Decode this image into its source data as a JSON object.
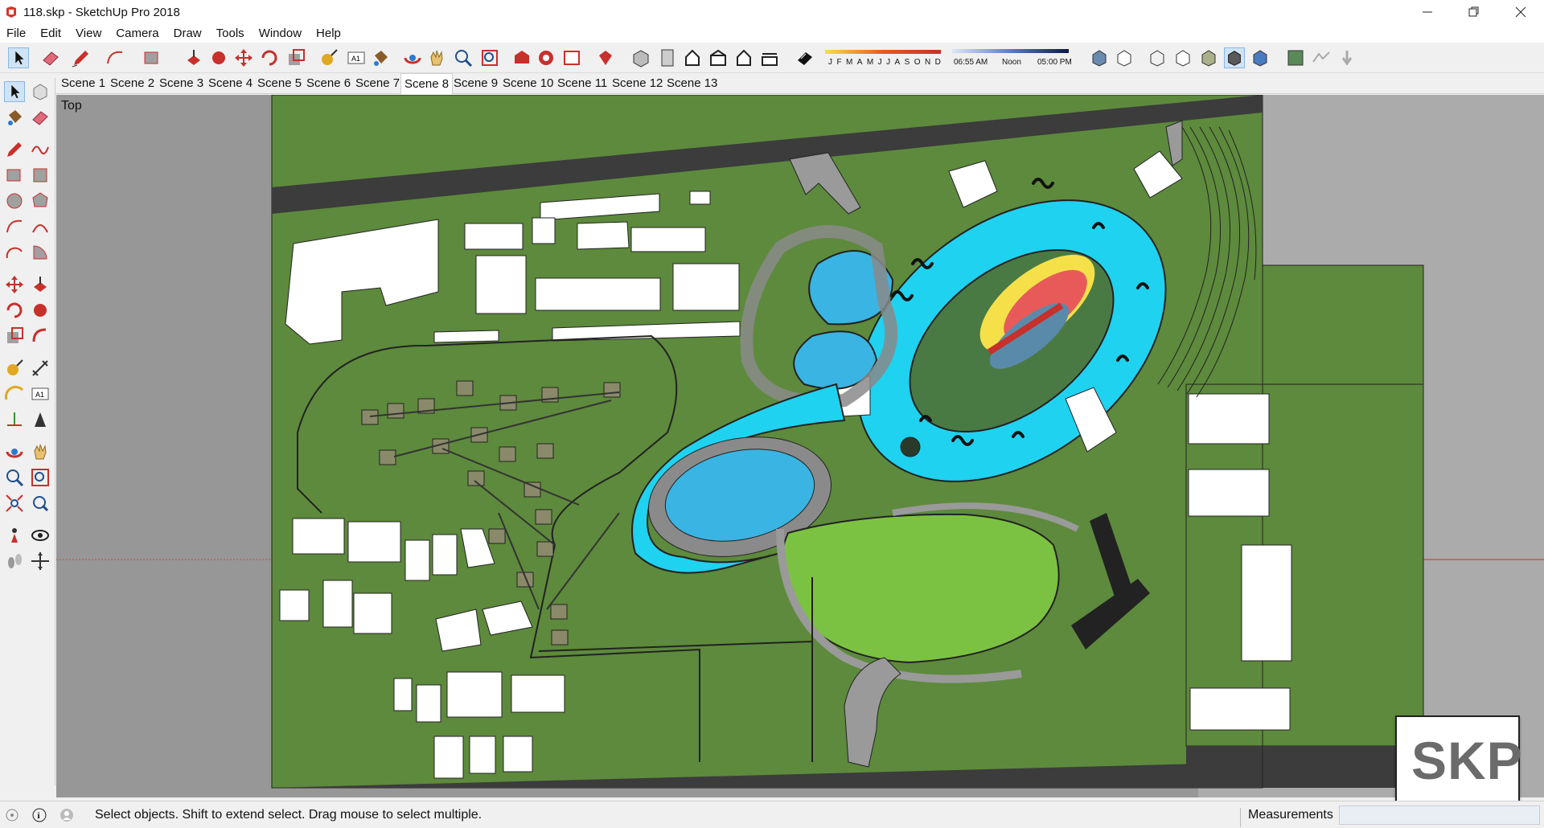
{
  "window": {
    "title": "118.skp - SketchUp Pro 2018",
    "minimize_icon": "minimize-icon",
    "restore_icon": "restore-icon",
    "close_icon": "close-icon"
  },
  "menu": [
    "File",
    "Edit",
    "View",
    "Camera",
    "Draw",
    "Tools",
    "Window",
    "Help"
  ],
  "shadow_bar": {
    "months": [
      "J",
      "F",
      "M",
      "A",
      "M",
      "J",
      "J",
      "A",
      "S",
      "O",
      "N",
      "D"
    ],
    "time_start": "06:55 AM",
    "time_mid": "Noon",
    "time_end": "05:00 PM"
  },
  "scenes": [
    "Scene 1",
    "Scene 2",
    "Scene 3",
    "Scene 4",
    "Scene 5",
    "Scene 6",
    "Scene 7",
    "Scene 8",
    "Scene 9",
    "Scene 10",
    "Scene 11",
    "Scene 12",
    "Scene 13"
  ],
  "active_scene": "Scene 8",
  "viewport": {
    "view_label": "Top"
  },
  "status": {
    "message": "Select objects. Shift to extend select. Drag mouse to select multiple.",
    "measurements_label": "Measurements",
    "measurements_value": ""
  },
  "logo": {
    "text": "SKP"
  },
  "colors": {
    "grass": "#5d8a3c",
    "lawn": "#7cc242",
    "water": "#1fd2f0",
    "pool": "#3ab4e2",
    "road": "#3c3c3c",
    "building": "#ffffff",
    "background_gray": "#979797"
  }
}
